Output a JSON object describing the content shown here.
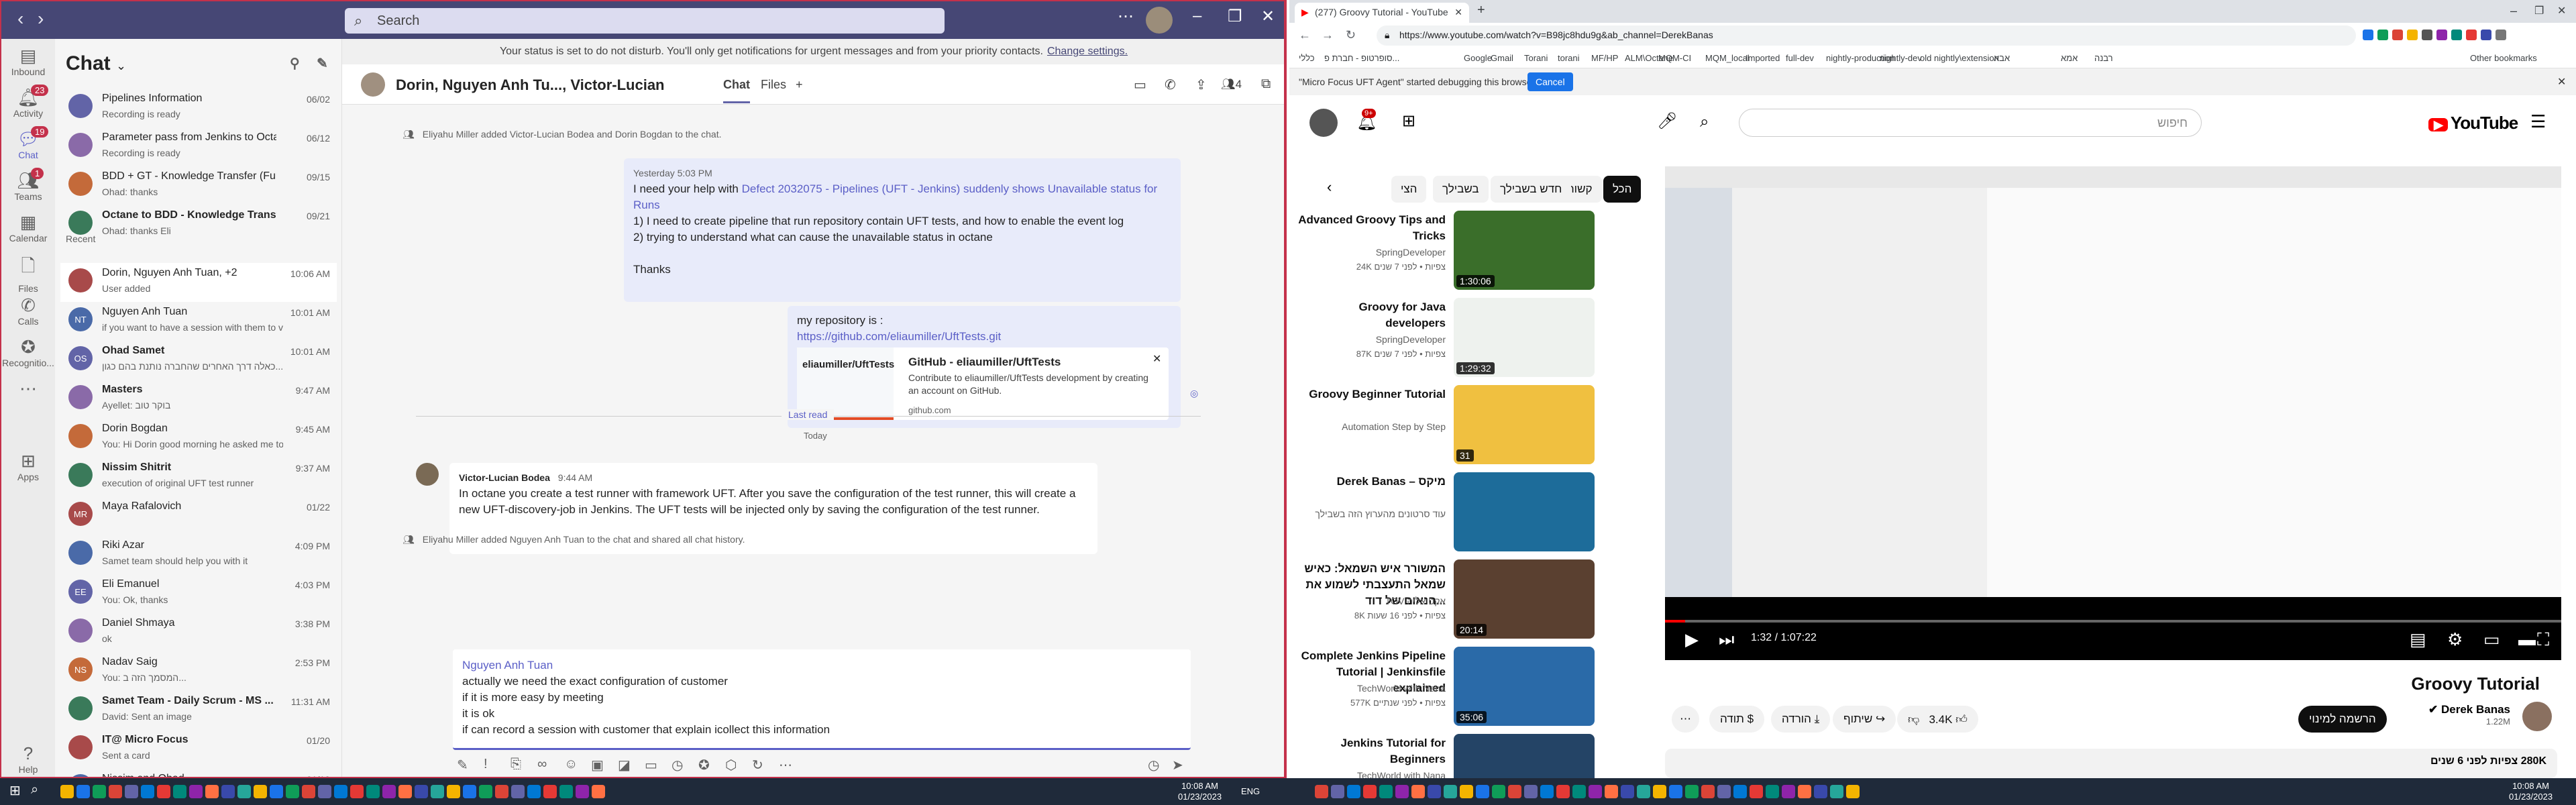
{
  "teams": {
    "search_placeholder": "Search",
    "rail": [
      {
        "label": "Inbound",
        "icon": "activity-icon"
      },
      {
        "label": "Activity",
        "badge": "23"
      },
      {
        "label": "Chat",
        "badge": "19"
      },
      {
        "label": "Teams",
        "badge": "1"
      },
      {
        "label": "Calendar"
      },
      {
        "label": "Files"
      },
      {
        "label": "Calls"
      },
      {
        "label": "Recognitio..."
      },
      {
        "label": "..."
      },
      {
        "label": "Apps"
      },
      {
        "label": "Help"
      }
    ],
    "list_title": "Chat",
    "recent_label": "Recent",
    "chats": [
      {
        "name": "Pipelines Information",
        "preview": "Recording is ready",
        "time": "06/02",
        "initials": ""
      },
      {
        "name": "Parameter pass from Jenkins to Octan...",
        "preview": "Recording is ready",
        "time": "06/12",
        "initials": ""
      },
      {
        "name": "BDD + GT - Knowledge Transfer (Func...",
        "preview": "Ohad: thanks",
        "time": "09/15",
        "initials": ""
      },
      {
        "name": "Octane to BDD - Knowledge Transfer",
        "preview": "Ohad: thanks Eli",
        "time": "09/21",
        "initials": "",
        "bold": true
      },
      {
        "name": "Dorin, Nguyen Anh Tuan, +2",
        "preview": "User added",
        "time": "10:06 AM",
        "initials": "",
        "selected": true
      },
      {
        "name": "Nguyen Anh Tuan",
        "preview": "if you want to have a session with them to val...",
        "time": "10:01 AM",
        "initials": "NT"
      },
      {
        "name": "Ohad Samet",
        "preview": "כאלה דרך האחרים שהחברה נותנת בהם כגון...",
        "time": "10:01 AM",
        "initials": "OS",
        "bold": true
      },
      {
        "name": "Masters",
        "preview": "Ayellet: בוקר טוב",
        "time": "9:47 AM",
        "initials": "",
        "bold": true
      },
      {
        "name": "Dorin Bogdan",
        "preview": "You: Hi Dorin good morning he asked me to ta...",
        "time": "9:45 AM",
        "initials": ""
      },
      {
        "name": "Nissim Shitrit",
        "preview": "execution of original UFT test runner",
        "time": "9:37 AM",
        "initials": "",
        "bold": true
      },
      {
        "name": "Maya Rafalovich",
        "preview": "",
        "time": "01/22",
        "initials": "MR"
      },
      {
        "name": "Riki Azar",
        "preview": "Samet team should help you with it",
        "time": "4:09 PM",
        "initials": ""
      },
      {
        "name": "Eli Emanuel",
        "preview": "You: Ok, thanks",
        "time": "4:03 PM",
        "initials": "EE"
      },
      {
        "name": "Daniel Shmaya",
        "preview": "ok",
        "time": "3:38 PM",
        "initials": ""
      },
      {
        "name": "Nadav Saig",
        "preview": "You: המסמך הזה ב...",
        "time": "2:53 PM",
        "initials": "NS"
      },
      {
        "name": "Samet Team - Daily Scrum - MS ...",
        "preview": "David: Sent an image",
        "time": "11:31 AM",
        "initials": "",
        "bold": true
      },
      {
        "name": "IT@ Micro Focus",
        "preview": "Sent a card",
        "time": "01/20",
        "initials": "",
        "bold": true
      },
      {
        "name": "Nissim and Ohad",
        "preview": "",
        "time": "01/19",
        "initials": ""
      }
    ],
    "banner_text": "Your status is set to do not disturb. You'll only get notifications for urgent messages and from your priority contacts.",
    "banner_link": "Change settings.",
    "chat_title": "Dorin, Nguyen Anh Tu..., Victor-Lucian",
    "tab_chat": "Chat",
    "tab_files": "Files",
    "tab_add": "+",
    "participants": "4",
    "sys1": "Eliyahu Miller added Victor-Lucian Bodea and Dorin Bogdan to the chat.",
    "msg1_time": "Yesterday 5:03 PM",
    "msg1_line1": "I need your help with",
    "msg1_link": "Defect 2032075 - Pipelines (UFT - Jenkins) suddenly shows Unavailable status for Runs",
    "msg1_line2": "1) I need to create pipeline that run repository contain UFT tests, and how to enable the event log",
    "msg1_line3": "2) trying to understand what can cause the unavailable status in octane",
    "msg1_line4": "Thanks",
    "msg2_line1": "my repository is :",
    "msg2_url": "https://github.com/eliaumiller/UftTests.git",
    "card_site": "eliaumiller/UftTests",
    "card_title": "GitHub - eliaumiller/UftTests",
    "card_desc": "Contribute to eliaumiller/UftTests development by creating an account on GitHub.",
    "card_domain": "github.com",
    "last_read": "Last read",
    "today": "Today",
    "msg3_author": "Victor-Lucian Bodea",
    "msg3_time": "9:44 AM",
    "msg3_text": "In octane you create a test runner with framework UFT. After you save the configuration of the test runner, this will create a new UFT-discovery-job in Jenkins. The UFT tests will be injected only by saving the configuration of the test runner.",
    "sys2": "Eliyahu Miller added Nguyen Anh Tuan to the chat and shared all chat history.",
    "compose_to": "Nguyen Anh Tuan",
    "compose_lines": [
      "actually we need the exact configuration of customer",
      "if it is more easy by meeting",
      "it is ok",
      "if can record a session with customer that explain icollect this information"
    ]
  },
  "chrome": {
    "tab_title": "(277) Groovy Tutorial - YouTube",
    "url": "https://www.youtube.com/watch?v=B98jc8hdu9g&ab_channel=DerekBanas",
    "bookmarks": [
      "כללי",
      "סופרטופ - חברת פ...",
      "Google",
      "Gmail",
      "Torani",
      "torani",
      "MF/HP",
      "ALM\\Octane",
      "MQM-CI",
      "MQM_local",
      "Imported",
      "full-dev",
      "nightly-production",
      "nightly-dev",
      "old nightly\\extension",
      "אבא",
      "אמא",
      "רבנה",
      "Other bookmarks"
    ],
    "debug_text": "\"Micro Focus UFT Agent\" started debugging this browser",
    "debug_cancel": "Cancel"
  },
  "youtube": {
    "notif_badge": "9+",
    "search_placeholder": "חיפוש",
    "logo": "YouTube",
    "chips": [
      "הכל",
      "קשורים",
      "חדש בשבילך",
      "בשבילך",
      "הצי"
    ],
    "videos": [
      {
        "title": "Advanced Groovy Tips and Tricks",
        "channel": "SpringDeveloper",
        "meta": "24K צפיות • לפני 7 שנים",
        "dur": "1:30:06",
        "color": "#3a6e2a"
      },
      {
        "title": "Groovy for Java developers",
        "channel": "SpringDeveloper",
        "meta": "87K צפיות • לפני 7 שנים",
        "dur": "1:29:32",
        "color": "#eef2ee"
      },
      {
        "title": "Groovy Beginner Tutorial",
        "channel": "Automation Step by Step",
        "meta": "",
        "dur": "31",
        "color": "#f0c040"
      },
      {
        "title": "Derek Banas – מיקס",
        "channel": "עוד סרטונים מהערוץ הזה בשבילך",
        "meta": "",
        "dur": "",
        "color": "#1d6c9a"
      },
      {
        "title": "המשורר איש השמאל: כאיש שמאל התעצבתי לשמוע את הנאום של דוד...",
        "channel": "TOV אקטואליה",
        "meta": "8K צפיות • לפני 16 שעות",
        "dur": "20:14",
        "color": "#5a4030"
      },
      {
        "title": "Complete Jenkins Pipeline Tutorial | Jenkinsfile explained",
        "channel": "TechWorld with Nana",
        "meta": "577K צפיות • לפני שנתיים",
        "dur": "35:06",
        "color": "#2a6aa8"
      },
      {
        "title": "Jenkins Tutorial for Beginners",
        "channel": "TechWorld with Nana",
        "meta": "",
        "dur": "6",
        "color": "#244466"
      }
    ],
    "player_time": "1:32 / 1:07:22",
    "video_title": "Groovy Tutorial",
    "channel": "Derek Banas",
    "subs": "1.22M",
    "subscribe": "הרשמה למינוי",
    "likes": "3.4K",
    "share": "שיתוף",
    "download": "הורדה",
    "thanks": "תודה",
    "views": "280K צפיות לפני 6 שנים"
  },
  "taskbar": {
    "time_left": "10:08 AM",
    "date_left": "01/23/2023",
    "time_right": "10:08 AM",
    "date_right": "01/23/2023",
    "lang": "ENG"
  }
}
